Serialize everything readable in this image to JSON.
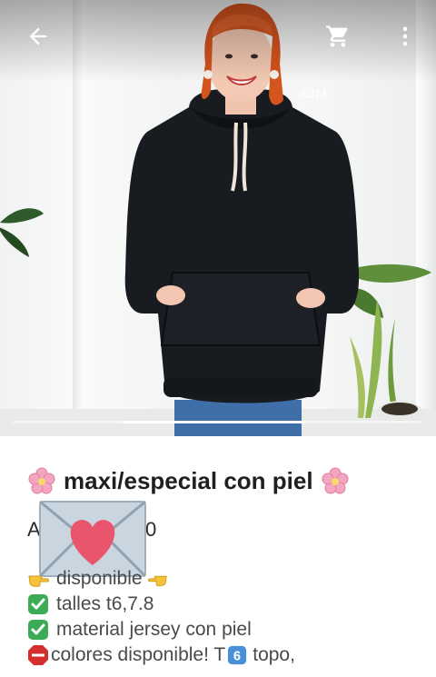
{
  "toolbar": {
    "back_icon": "arrow-back-icon",
    "cart_icon": "shopping-cart-icon",
    "more_icon": "more-vert-icon"
  },
  "photo": {
    "watermark": "AJM"
  },
  "product": {
    "title": "maxi/especial con piel",
    "title_icon": "cherry-blossom-icon",
    "price_visible_start": "A",
    "price_visible_end": "0",
    "price_overlay_icon": "love-letter-icon"
  },
  "description": {
    "line1": "disponible",
    "line2": "talles t6,7.8",
    "line3": "material jersey con piel",
    "line4_a": "colores disponible! T",
    "line4_b": "topo,",
    "icons": {
      "pointing": "backhand-index-pointing-right-icon",
      "check": "check-mark-button-icon",
      "stop": "stop-sign-icon",
      "keycap": "keycap-6-icon"
    }
  },
  "colors": {
    "check_green": "#3dab55",
    "stop_red": "#d32f2f",
    "keycap_blue": "#4a90d9",
    "flower_pink": "#f4a6c0"
  }
}
